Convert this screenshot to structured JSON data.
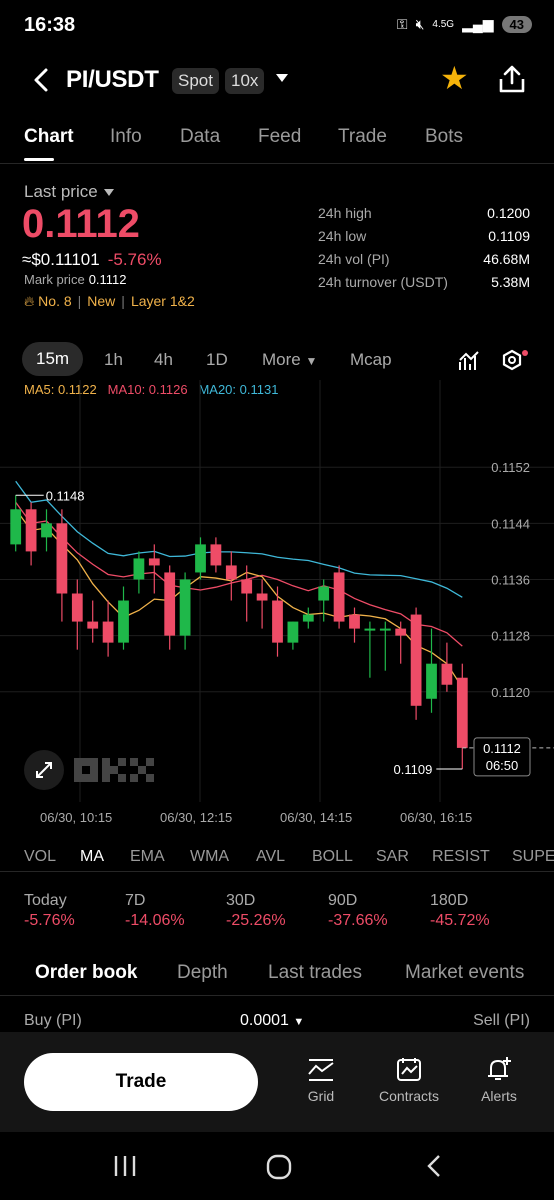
{
  "status": {
    "time": "16:38",
    "network": "4.5G",
    "battery": "43"
  },
  "header": {
    "pair": "PI/USDT",
    "market": "Spot",
    "leverage": "10x"
  },
  "tabs": [
    "Chart",
    "Info",
    "Data",
    "Feed",
    "Trade",
    "Bots"
  ],
  "price": {
    "last_label": "Last price",
    "last_value": "0.1112",
    "usd_value": "≈$0.11101",
    "change": "-5.76%",
    "mark_label": "Mark price",
    "mark_value": "0.1112",
    "tag_rank": "No. 8",
    "tag_new": "New",
    "tag_layer": "Layer 1&2"
  },
  "stats": [
    {
      "k": "24h high",
      "v": "0.1200"
    },
    {
      "k": "24h low",
      "v": "0.1109"
    },
    {
      "k": "24h vol (PI)",
      "v": "46.68M"
    },
    {
      "k": "24h turnover (USDT)",
      "v": "5.38M"
    }
  ],
  "timeframes": [
    "15m",
    "1h",
    "4h",
    "1D",
    "More",
    "Mcap"
  ],
  "ma": {
    "ma5": "MA5: 0.1122",
    "ma10": "MA10: 0.1126",
    "ma20": "MA20: 0.1131"
  },
  "colors": {
    "up": "#1fb84a",
    "down": "#ee4c67",
    "ma5": "#f0b24a",
    "ma10": "#ee4c67",
    "ma20": "#3fb8d8"
  },
  "chart_data": {
    "type": "candlestick",
    "y_ticks": [
      "0.1152",
      "0.1144",
      "0.1136",
      "0.1128",
      "0.1120"
    ],
    "ylim": [
      0.1106,
      0.1163
    ],
    "x_ticks": [
      "06/30, 10:15",
      "06/30, 12:15",
      "06/30, 14:15",
      "06/30, 16:15"
    ],
    "annotations": {
      "high": "0.1148",
      "low": "0.1109",
      "current_price": "0.1112",
      "countdown": "06:50"
    },
    "candles": [
      {
        "o": 0.1141,
        "h": 0.1148,
        "c": 0.1146,
        "l": 0.114
      },
      {
        "o": 0.1146,
        "h": 0.1147,
        "c": 0.114,
        "l": 0.1138
      },
      {
        "o": 0.1142,
        "h": 0.1146,
        "c": 0.1144,
        "l": 0.114
      },
      {
        "o": 0.1144,
        "h": 0.1146,
        "c": 0.1134,
        "l": 0.113
      },
      {
        "o": 0.1134,
        "h": 0.1136,
        "c": 0.113,
        "l": 0.1126
      },
      {
        "o": 0.113,
        "h": 0.1133,
        "c": 0.1129,
        "l": 0.1127
      },
      {
        "o": 0.113,
        "h": 0.1133,
        "c": 0.1127,
        "l": 0.1125
      },
      {
        "o": 0.1127,
        "h": 0.1135,
        "c": 0.1133,
        "l": 0.1126
      },
      {
        "o": 0.1136,
        "h": 0.114,
        "c": 0.1139,
        "l": 0.1134
      },
      {
        "o": 0.1139,
        "h": 0.1141,
        "c": 0.1138,
        "l": 0.1134
      },
      {
        "o": 0.1137,
        "h": 0.1138,
        "c": 0.1128,
        "l": 0.1126
      },
      {
        "o": 0.1128,
        "h": 0.1137,
        "c": 0.1136,
        "l": 0.1126
      },
      {
        "o": 0.1137,
        "h": 0.1142,
        "c": 0.1141,
        "l": 0.1136
      },
      {
        "o": 0.1141,
        "h": 0.1142,
        "c": 0.1138,
        "l": 0.1137
      },
      {
        "o": 0.1138,
        "h": 0.114,
        "c": 0.1136,
        "l": 0.1133
      },
      {
        "o": 0.1136,
        "h": 0.1138,
        "c": 0.1134,
        "l": 0.113
      },
      {
        "o": 0.1134,
        "h": 0.1136,
        "c": 0.1133,
        "l": 0.1129
      },
      {
        "o": 0.1133,
        "h": 0.1135,
        "c": 0.1127,
        "l": 0.1125
      },
      {
        "o": 0.1127,
        "h": 0.113,
        "c": 0.113,
        "l": 0.1126
      },
      {
        "o": 0.113,
        "h": 0.1132,
        "c": 0.1131,
        "l": 0.1129
      },
      {
        "o": 0.1133,
        "h": 0.1136,
        "c": 0.1135,
        "l": 0.113
      },
      {
        "o": 0.1137,
        "h": 0.1138,
        "c": 0.113,
        "l": 0.1129
      },
      {
        "o": 0.1131,
        "h": 0.1132,
        "c": 0.1129,
        "l": 0.1127
      },
      {
        "o": 0.1129,
        "h": 0.113,
        "c": 0.1129,
        "l": 0.1122
      },
      {
        "o": 0.1129,
        "h": 0.113,
        "c": 0.1129,
        "l": 0.1123
      },
      {
        "o": 0.1129,
        "h": 0.113,
        "c": 0.1128,
        "l": 0.1124
      },
      {
        "o": 0.1131,
        "h": 0.1132,
        "c": 0.1118,
        "l": 0.1116
      },
      {
        "o": 0.1119,
        "h": 0.1129,
        "c": 0.1124,
        "l": 0.1117
      },
      {
        "o": 0.1124,
        "h": 0.1127,
        "c": 0.1121,
        "l": 0.112
      },
      {
        "o": 0.1122,
        "h": 0.1124,
        "c": 0.1112,
        "l": 0.1109
      }
    ]
  },
  "indicators": [
    "VOL",
    "MA",
    "EMA",
    "WMA",
    "AVL",
    "BOLL",
    "SAR",
    "RESIST",
    "SUPE"
  ],
  "performance": [
    {
      "label": "Today",
      "value": "-5.76%"
    },
    {
      "label": "7D",
      "value": "-14.06%"
    },
    {
      "label": "30D",
      "value": "-25.26%"
    },
    {
      "label": "90D",
      "value": "-37.66%"
    },
    {
      "label": "180D",
      "value": "-45.72%"
    }
  ],
  "order_tabs": [
    "Order book",
    "Depth",
    "Last trades",
    "Market events"
  ],
  "order_book": {
    "buy": "Buy (PI)",
    "step": "0.0001",
    "sell": "Sell (PI)"
  },
  "bottom": {
    "trade": "Trade",
    "grid": "Grid",
    "contracts": "Contracts",
    "alerts": "Alerts"
  }
}
